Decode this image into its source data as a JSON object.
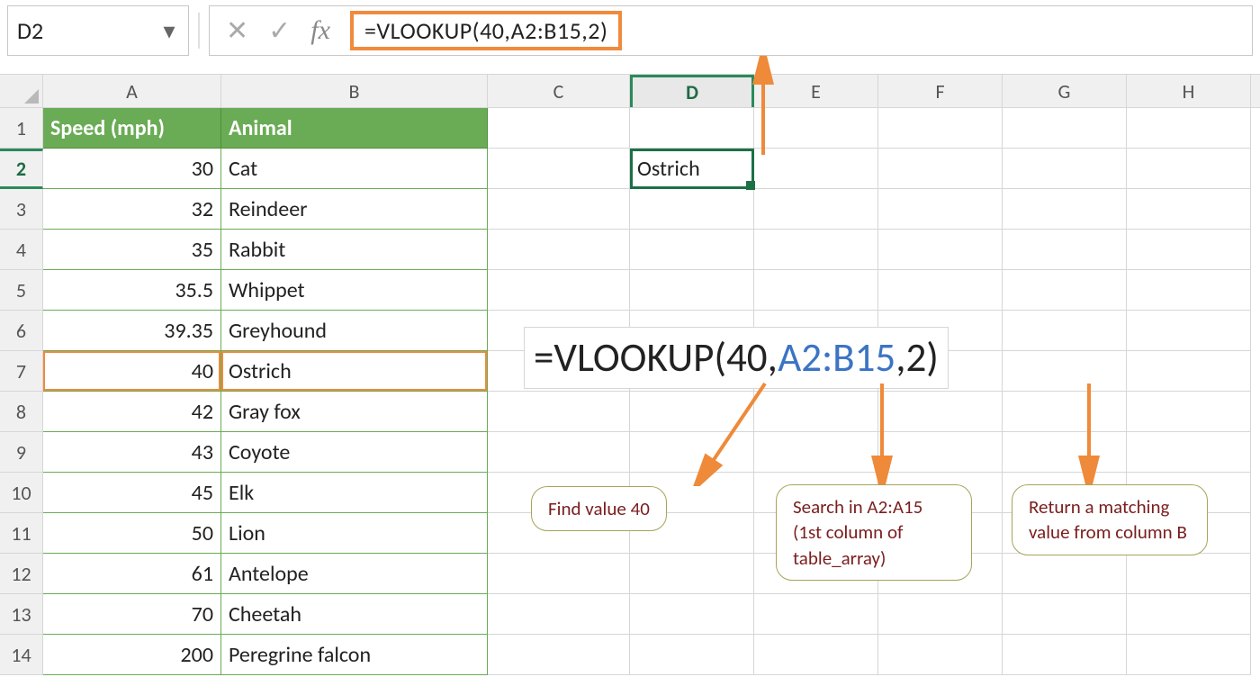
{
  "namebox": {
    "value": "D2"
  },
  "formula_bar": {
    "text": "=VLOOKUP(40,A2:B15,2)"
  },
  "columns": [
    "A",
    "B",
    "C",
    "D",
    "E",
    "F",
    "G",
    "H"
  ],
  "headers": {
    "A": "Speed (mph)",
    "B": "Animal"
  },
  "rows": [
    {
      "n": 1
    },
    {
      "n": 2,
      "A": "30",
      "B": "Cat",
      "D": "Ostrich"
    },
    {
      "n": 3,
      "A": "32",
      "B": "Reindeer"
    },
    {
      "n": 4,
      "A": "35",
      "B": "Rabbit"
    },
    {
      "n": 5,
      "A": "35.5",
      "B": "Whippet"
    },
    {
      "n": 6,
      "A": "39.35",
      "B": "Greyhound"
    },
    {
      "n": 7,
      "A": "40",
      "B": "Ostrich"
    },
    {
      "n": 8,
      "A": "42",
      "B": "Gray fox"
    },
    {
      "n": 9,
      "A": "43",
      "B": "Coyote"
    },
    {
      "n": 10,
      "A": "45",
      "B": "Elk"
    },
    {
      "n": 11,
      "A": "50",
      "B": "Lion"
    },
    {
      "n": 12,
      "A": "61",
      "B": "Antelope"
    },
    {
      "n": 13,
      "A": "70",
      "B": "Cheetah"
    },
    {
      "n": 14,
      "A": "200",
      "B": "Peregrine falcon"
    }
  ],
  "selected_cell": "D2",
  "highlight_row": 7,
  "big_formula": {
    "prefix": "=VLOOKUP(",
    "arg1": "40",
    "sep1": ",",
    "arg2": "A2:B15",
    "sep2": ",",
    "arg3": "2",
    "suffix": ")"
  },
  "callouts": {
    "c1": "Find value 40",
    "c2": "Search in A2:A15 (1st column of table_array)",
    "c3": "Return a matching value from column B"
  },
  "icons": {
    "dropdown": "▾",
    "cancel": "✕",
    "enter": "✓",
    "fx": "fx"
  }
}
